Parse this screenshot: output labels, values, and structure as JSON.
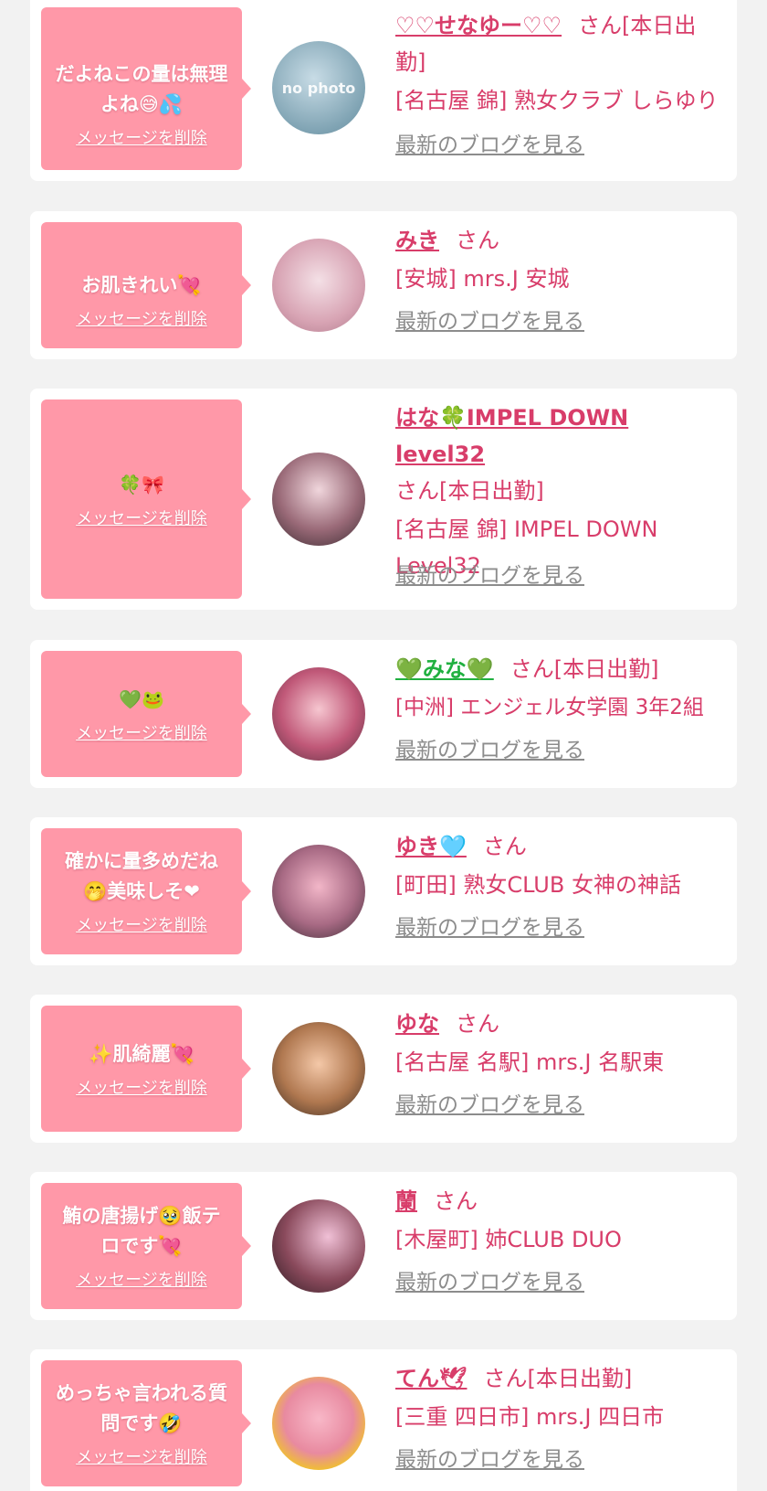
{
  "common": {
    "delete_label": "メッセージを削除",
    "blog_label": "最新のブログを見る",
    "san_label": "さん"
  },
  "colors": {
    "bubble": "#ff98a8",
    "name": "#d83d6a",
    "blog_link": "#8c8c8c",
    "background": "#f2f2f2"
  },
  "items": [
    {
      "message": "だよねこの量は無理よね",
      "message_emoji": "😅💦",
      "name": "♡♡せなゆー♡♡",
      "suffix": "さん[本日出勤]",
      "shop": "[名古屋 錦] 熟女クラブ しらゆり",
      "avatar_text": "no photo",
      "avatar_icon": "no-photo-placeholder"
    },
    {
      "message": "お肌きれい",
      "message_emoji": "💘",
      "name": "みき",
      "suffix": "さん",
      "shop": "[安城] mrs.J 安城",
      "avatar_text": "",
      "avatar_icon": "profile-photo"
    },
    {
      "message": "",
      "message_emoji": "🍀🎀",
      "name": "はな🍀IMPEL DOWN level32",
      "suffix": "さん[本日出勤]",
      "shop": "[名古屋 錦] IMPEL DOWN Level32",
      "avatar_text": "",
      "avatar_icon": "profile-photo"
    },
    {
      "message": "",
      "message_emoji": "💚🐸",
      "name": "💚みな💚",
      "suffix": "さん[本日出勤]",
      "shop": "[中洲] エンジェル女学園 3年2組",
      "avatar_text": "",
      "avatar_icon": "profile-photo"
    },
    {
      "message": "確かに量多めだね\n🤭美味しそ❤",
      "message_emoji": "",
      "name": "ゆき🩵",
      "suffix": "さん",
      "shop": "[町田] 熟女CLUB 女神の神話",
      "avatar_text": "",
      "avatar_icon": "profile-photo"
    },
    {
      "message": "✨肌綺麗💘",
      "message_emoji": "",
      "name": "ゆな",
      "suffix": "さん",
      "shop": "[名古屋 名駅] mrs.J 名駅東",
      "avatar_text": "",
      "avatar_icon": "profile-photo"
    },
    {
      "message": "鮪の唐揚げ🥹飯テロです💘",
      "message_emoji": "",
      "name": "蘭",
      "suffix": "さん",
      "shop": "[木屋町] 姉CLUB DUO",
      "avatar_text": "",
      "avatar_icon": "profile-photo"
    },
    {
      "message": "めっちゃ言われる質問です🤣",
      "message_emoji": "",
      "name": "てん🕊",
      "suffix": "さん[本日出勤]",
      "shop": "[三重 四日市] mrs.J 四日市",
      "avatar_text": "",
      "avatar_icon": "profile-photo"
    }
  ]
}
